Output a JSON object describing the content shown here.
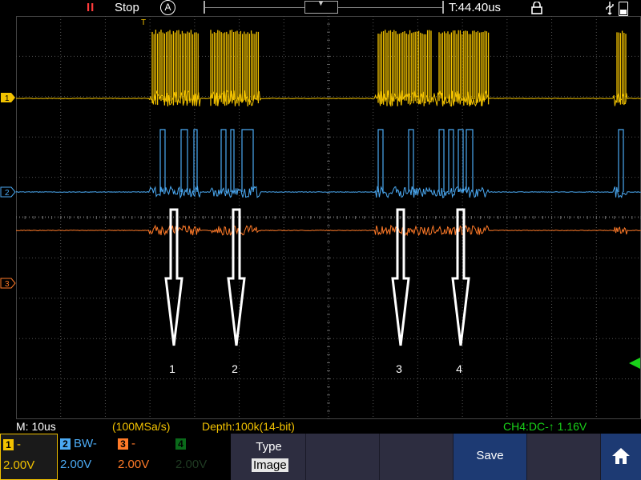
{
  "topbar": {
    "run_indicator": "II",
    "run_state": "Stop",
    "trigger_mode": "A",
    "timebase_marker": "▼",
    "trigger_time": "T:44.40us"
  },
  "infobar": {
    "timebase": "M: 10us",
    "sample_rate": "(100MSa/s)",
    "depth": "Depth:100k(14-bit)",
    "trigger": "CH4:DC-↑  1.16V"
  },
  "channels": [
    {
      "num": "1",
      "coupling": "-",
      "volts": "2.00V",
      "color": "#f2c200",
      "marker": "1"
    },
    {
      "num": "2",
      "coupling": "BW-",
      "volts": "2.00V",
      "color": "#4ba9f2",
      "marker": "2"
    },
    {
      "num": "3",
      "coupling": "-",
      "volts": "2.00V",
      "color": "#ff7a28",
      "marker": "3"
    },
    {
      "num": "4",
      "coupling": "",
      "volts": "2.00V",
      "color": "#0a6a1a"
    }
  ],
  "trigger_marker": "T",
  "annotations": [
    "1",
    "2",
    "3",
    "4"
  ],
  "menu": {
    "type_label": "Type",
    "type_value": "Image",
    "save_label": "Save"
  },
  "colors": {
    "ch4_trigger_marker": "#19d219",
    "menu_bg": "#2d2d40",
    "save_bg": "#1d3a73"
  },
  "icons": [
    "auto-trigger-icon",
    "lock-icon",
    "usb-icon",
    "battery-icon",
    "home-icon",
    "down-arrow-icon"
  ]
}
